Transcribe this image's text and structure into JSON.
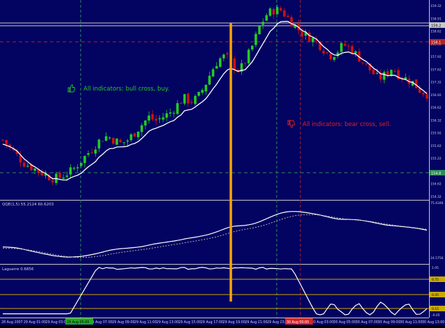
{
  "colors": {
    "background": "#030361",
    "frame": "#c8c8c8",
    "bull_candle": "#22cc22",
    "bear_candle": "#cc1111",
    "ma_line": "#ffffff",
    "signal_line": "#b0b0b0",
    "annotation_bull": "#22cc22",
    "annotation_bear": "#dd2222",
    "highlight_marker": "#ffa500",
    "level_line": "#c8a800",
    "grid_vertical": "#2e8b57",
    "grid_red": "#b22222",
    "axis_text": "#cfd3e8"
  },
  "main_panel": {
    "price_labels": [
      "159.32",
      "158.91",
      "158.62",
      "158.32",
      "157.92",
      "157.62",
      "157.32",
      "156.92",
      "156.62",
      "156.32",
      "155.92",
      "155.62",
      "155.22",
      "154.91",
      "154.62",
      "154.32"
    ],
    "bid_label": "159.2",
    "red_level_label": "158.1",
    "green_level_label": "154.8",
    "annotation_bull": {
      "icon": "thumbs-up-icon",
      "text": "All indicators: bull cross, buy."
    },
    "annotation_bear": {
      "icon": "thumbs-down-icon",
      "text": "All indicators: bear cross, sell."
    }
  },
  "qqe_panel": {
    "title": "QQE(1,5) 55.2124 60.6203",
    "labels": [
      "75.4346",
      "24.5756"
    ]
  },
  "laguerre_panel": {
    "title": "Laguerre 0.6856",
    "labels": [
      "1.05",
      "0.75",
      "0.45",
      "0.15",
      "-0.05"
    ]
  },
  "time_axis": {
    "labels": [
      "28 Aug 2007",
      "29 Aug 01:00",
      "29 Aug 03:00",
      "29 Aug 05:00",
      "29 Aug 07:00",
      "29 Aug 09:00",
      "29 Aug 11:00",
      "29 Aug 13:00",
      "29 Aug 15:00",
      "29 Aug 17:00",
      "29 Aug 19:00",
      "29 Aug 21:00",
      "29 Aug 23:00",
      "30 Aug 01:00",
      "30 Aug 03:00",
      "30 Aug 05:00",
      "30 Aug 07:00",
      "30 Aug 09:00",
      "30 Aug 11:00",
      "30 Aug 13:00"
    ],
    "highlight_green": "29 Aug 05:00",
    "highlight_red": "30 Aug 00:00"
  },
  "chart_data": {
    "type": "candlestick",
    "price_axis": {
      "min": 154.32,
      "max": 159.32
    },
    "prices_approx": [
      155.8,
      155.6,
      155.4,
      155.2,
      155.1,
      155.0,
      154.9,
      154.8,
      154.8,
      154.9,
      155.0,
      155.2,
      155.4,
      155.6,
      155.8,
      155.9,
      155.8,
      155.7,
      155.8,
      156.0,
      156.2,
      156.4,
      156.3,
      156.4,
      156.5,
      156.7,
      156.9,
      156.8,
      156.9,
      157.2,
      157.6,
      157.9,
      158.0,
      157.8,
      157.6,
      157.9,
      158.3,
      158.8,
      159.1,
      159.2,
      159.2,
      159.0,
      158.8,
      158.6,
      158.5,
      158.4,
      158.2,
      158.0,
      158.1,
      158.3,
      158.2,
      158.0,
      157.8,
      157.6,
      157.4,
      157.5,
      157.7,
      157.5,
      157.4,
      157.3,
      157.1,
      157.0
    ]
  }
}
